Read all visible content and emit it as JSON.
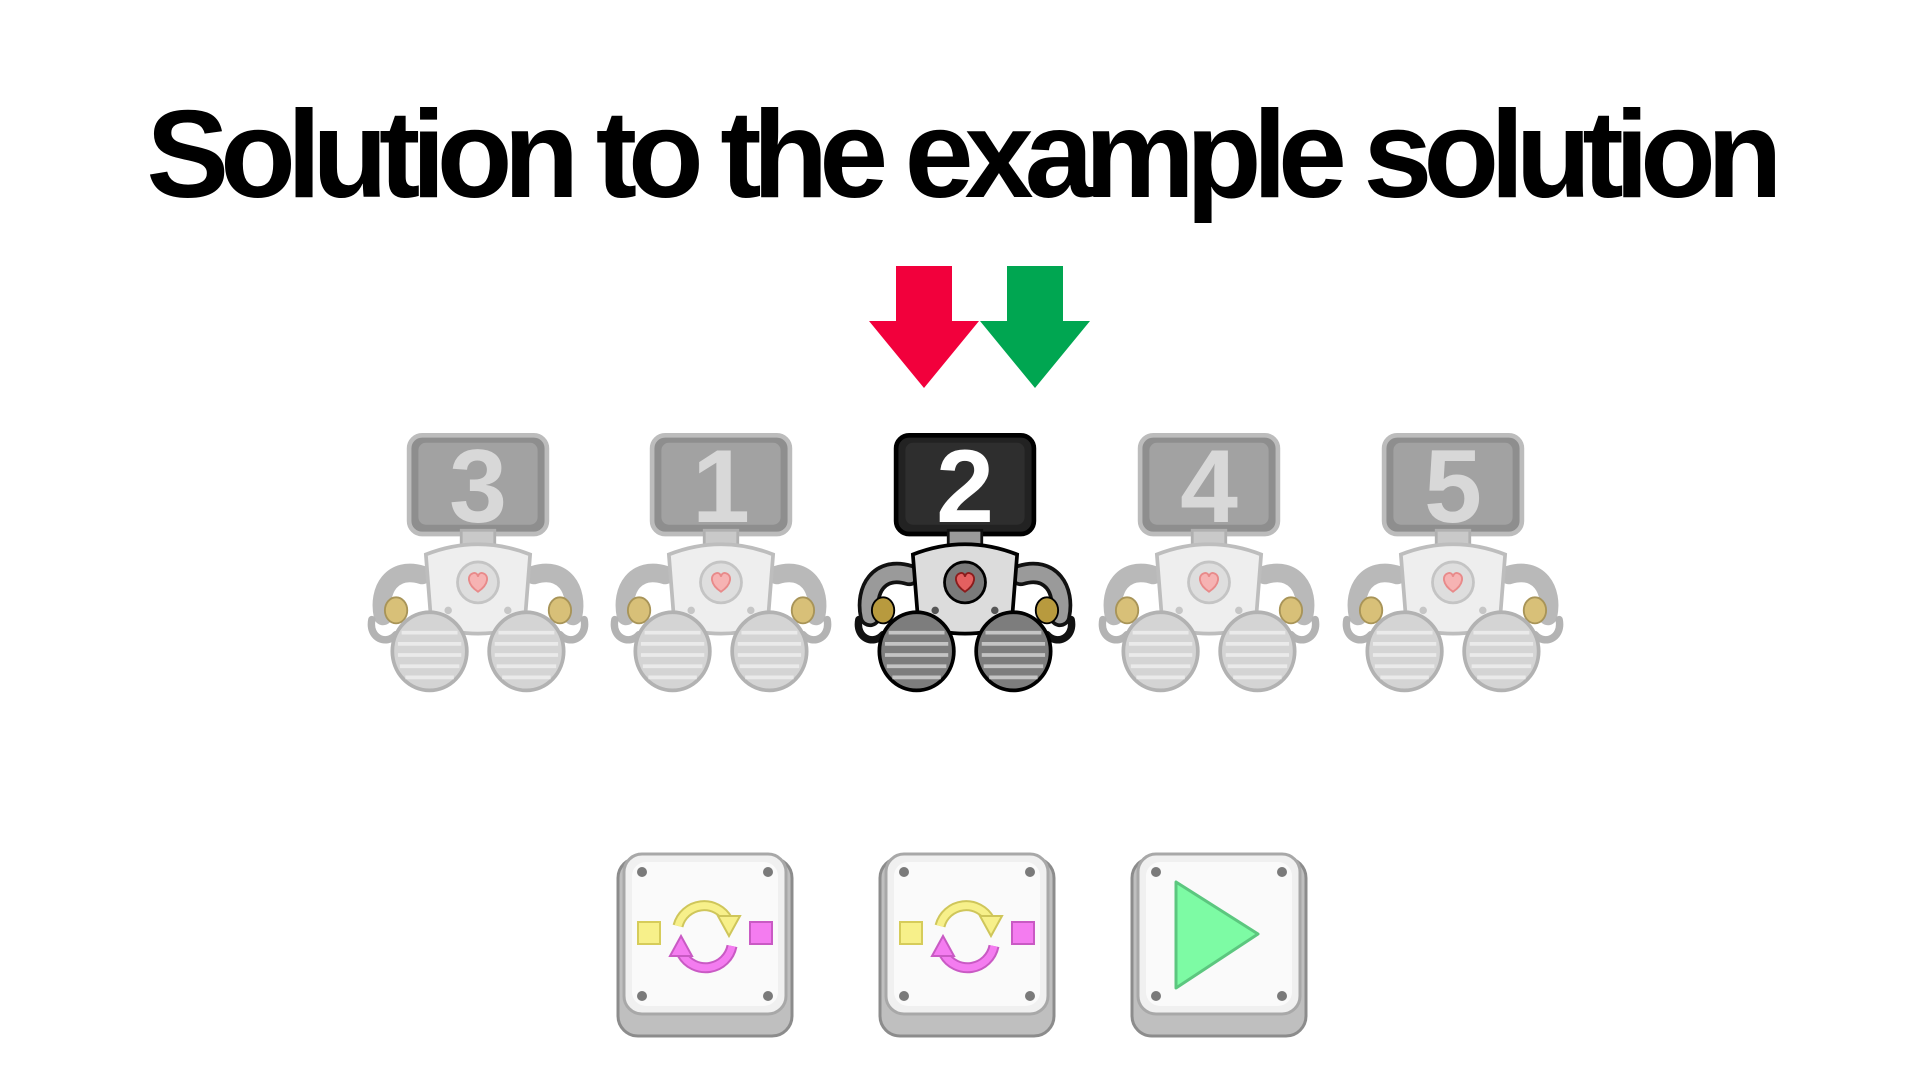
{
  "slide": {
    "title": "Solution to the example solution"
  },
  "pointers": {
    "red": {
      "icon": "down-arrow-icon",
      "color": "#f2003c"
    },
    "green": {
      "icon": "down-arrow-icon",
      "color": "#00a651"
    }
  },
  "robots": [
    {
      "number": "3",
      "state": "inactive"
    },
    {
      "number": "1",
      "state": "inactive"
    },
    {
      "number": "2",
      "state": "active"
    },
    {
      "number": "4",
      "state": "inactive"
    },
    {
      "number": "5",
      "state": "inactive"
    }
  ],
  "commands": [
    {
      "type": "swap",
      "icon": "swap-icon"
    },
    {
      "type": "swap",
      "icon": "swap-icon"
    },
    {
      "type": "play",
      "icon": "play-icon"
    }
  ],
  "colors": {
    "pointer_red": "#f2003c",
    "pointer_green": "#00a651",
    "swap_left": "#f7f08a",
    "swap_right": "#f47cf0",
    "play": "#7dfba4",
    "active_screen": "#222222",
    "inactive_screen": "#8c8c8c"
  }
}
